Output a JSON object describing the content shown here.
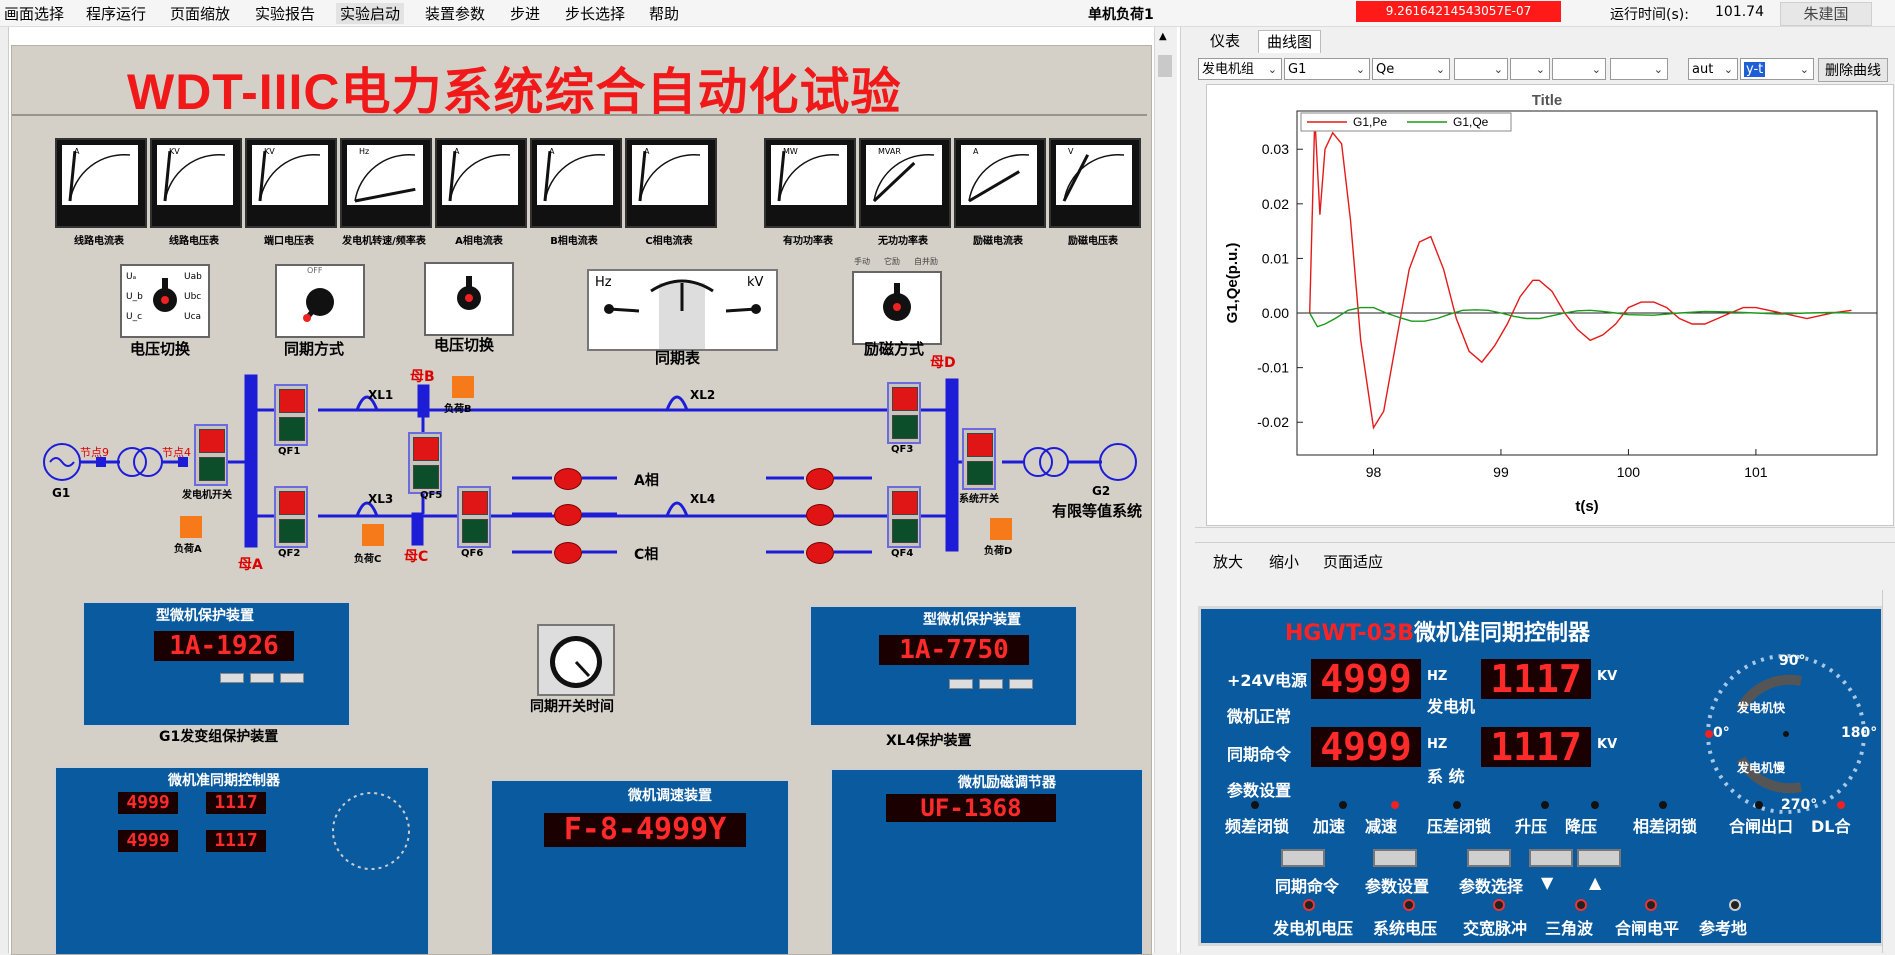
{
  "menu": {
    "items": [
      "画面选择",
      "程序运行",
      "页面缩放",
      "实验报告",
      "实验启动",
      "装置参数",
      "步进",
      "步长选择",
      "帮助"
    ],
    "mode": "单机负荷1",
    "warning": "9.26164214543057E-07",
    "runtime_label": "运行时间(s):",
    "runtime_value": "101.74",
    "user": "朱建国"
  },
  "panel": {
    "title": "WDT-IIIC电力系统综合自动化试验",
    "meters_left": [
      {
        "unit": "A",
        "label": "线路电流表",
        "needle": 0.05
      },
      {
        "unit": "KV",
        "label": "线路电压表",
        "needle": 0.05
      },
      {
        "unit": "KV",
        "label": "端口电压表",
        "needle": 0.05
      },
      {
        "unit": "Hz",
        "label": "发电机转速/频率表",
        "needle": 0.85
      },
      {
        "unit": "A",
        "label": "A相电流表",
        "needle": 0.05
      },
      {
        "unit": "A",
        "label": "B相电流表",
        "needle": 0.05
      },
      {
        "unit": "A",
        "label": "C相电流表",
        "needle": 0.05
      }
    ],
    "meters_right": [
      {
        "unit": "MW",
        "label": "有功功率表",
        "needle": 0.05
      },
      {
        "unit": "MVAR",
        "label": "无功功率表",
        "needle": 0.45
      },
      {
        "unit": "A",
        "label": "励磁电流表",
        "needle": 0.6
      },
      {
        "unit": "V",
        "label": "励磁电压表",
        "needle": 0.25
      }
    ],
    "switches": {
      "voltage_switch_1": "电压切换",
      "sync_mode": "同期方式",
      "voltage_switch_2": "电压切换",
      "sync_meter": "同期表",
      "excitation_mode": "励磁方式",
      "sync_off": "OFF",
      "exc_labels": [
        "手动",
        "它励",
        "自并励"
      ],
      "knob_ua": "Uₐ",
      "knob_ub": "U_b",
      "knob_uc": "U_c",
      "knob_uab": "Uab",
      "knob_ubc": "Ubc",
      "knob_uca": "Uca",
      "sync_hz": "Hz",
      "sync_kv": "kV"
    },
    "diagram": {
      "g1": "G1",
      "g2": "G2",
      "node9": "节点9",
      "node4": "节点4",
      "gen_switch": "发电机开关",
      "sys_switch": "系统开关",
      "inf_sys": "有限等值系统",
      "xl1": "XL1",
      "xl2": "XL2",
      "xl3": "XL3",
      "xl4": "XL4",
      "qf1": "QF1",
      "qf2": "QF2",
      "qf3": "QF3",
      "qf4": "QF4",
      "qf5": "QF5",
      "qf6": "QF6",
      "bus_a": "母A",
      "bus_b": "母B",
      "bus_c": "母C",
      "bus_d": "母D",
      "load_a": "负荷A",
      "load_b": "负荷B",
      "load_c": "负荷C",
      "load_d": "负荷D",
      "phase_a": "A相",
      "phase_c": "C相"
    },
    "prot1": {
      "title": "型微机保护装置",
      "disp": "1A-1926",
      "caption": "G1发变组保护装置"
    },
    "prot2": {
      "title": "型微机保护装置",
      "disp": "1A-7750",
      "caption": "XL4保护装置"
    },
    "sync_timer": "同期开关时间",
    "small_sync": {
      "title": "微机准同期控制器",
      "d1": "4999",
      "d2": "1117",
      "d3": "4999",
      "d4": "1117"
    },
    "speed": {
      "title": "微机调速装置",
      "disp": "F-8-4999Y"
    },
    "exc": {
      "title": "微机励磁调节器",
      "disp": "UF-1368"
    }
  },
  "right": {
    "tabs": [
      "仪表",
      "曲线图"
    ],
    "selects": [
      "发电机组",
      "G1",
      "Qe",
      "",
      "",
      "",
      "",
      "aut",
      "y-t"
    ],
    "delete_btn": "删除曲线",
    "toolbar": [
      "放大",
      "缩小",
      "页面适应"
    ]
  },
  "chart_data": {
    "type": "line",
    "title": "Title",
    "xlabel": "t(s)",
    "ylabel": "G1,Qe(p.u.)",
    "xlim": [
      97.4,
      101.95
    ],
    "ylim": [
      -0.026,
      0.037
    ],
    "xticks": [
      98,
      99,
      100,
      101
    ],
    "yticks": [
      0.03,
      0.02,
      0.01,
      0.0,
      -0.01,
      -0.02
    ],
    "ytick_labels": [
      "0.03",
      "0.02",
      "0.01",
      "0.00",
      "-0.01",
      "-0.02"
    ],
    "legend_placement": "top-left",
    "series": [
      {
        "name": "G1,Pe",
        "color": "#e41a1a",
        "x": [
          97.5,
          97.54,
          97.58,
          97.62,
          97.68,
          97.75,
          97.82,
          97.9,
          98.0,
          98.08,
          98.18,
          98.28,
          98.36,
          98.45,
          98.55,
          98.65,
          98.75,
          98.85,
          98.95,
          99.05,
          99.15,
          99.25,
          99.3,
          99.4,
          99.5,
          99.6,
          99.7,
          99.8,
          99.9,
          100.0,
          100.1,
          100.2,
          100.3,
          100.4,
          100.5,
          100.6,
          100.7,
          100.8,
          100.9,
          101.0,
          101.2,
          101.4,
          101.6,
          101.75
        ],
        "y": [
          0.0,
          0.036,
          0.018,
          0.03,
          0.033,
          0.031,
          0.017,
          -0.005,
          -0.021,
          -0.018,
          -0.005,
          0.008,
          0.013,
          0.014,
          0.008,
          -0.001,
          -0.007,
          -0.009,
          -0.006,
          -0.002,
          0.003,
          0.006,
          0.006,
          0.004,
          0.0,
          -0.003,
          -0.005,
          -0.004,
          -0.002,
          0.001,
          0.002,
          0.002,
          0.001,
          -0.001,
          -0.002,
          -0.002,
          -0.001,
          0.0,
          0.001,
          0.001,
          0.0,
          -0.001,
          0.0,
          0.0005
        ]
      },
      {
        "name": "G1,Qe",
        "color": "#1a9a1a",
        "x": [
          97.5,
          97.56,
          97.62,
          97.7,
          97.8,
          97.9,
          98.0,
          98.1,
          98.2,
          98.3,
          98.4,
          98.5,
          98.6,
          98.7,
          98.8,
          98.9,
          99.0,
          99.1,
          99.2,
          99.3,
          99.4,
          99.5,
          99.6,
          99.7,
          99.8,
          99.9,
          100.0,
          100.2,
          100.4,
          100.6,
          100.8,
          101.0,
          101.2,
          101.4,
          101.6,
          101.75
        ],
        "y": [
          0.0,
          -0.0025,
          -0.002,
          -0.001,
          0.0005,
          0.001,
          0.001,
          0.0,
          -0.0008,
          -0.0015,
          -0.0015,
          -0.001,
          -0.0002,
          0.0005,
          0.0006,
          0.0005,
          0.0,
          -0.0006,
          -0.001,
          -0.001,
          -0.0005,
          0.0,
          0.0004,
          0.0005,
          0.0003,
          0.0,
          -0.0003,
          -0.0004,
          0.0,
          0.0003,
          0.0002,
          0.0,
          -0.0002,
          0.0,
          0.0001,
          0.0
        ]
      }
    ]
  },
  "big_sync": {
    "title_red": "HGWT-03B",
    "title": "微机准同期控制器",
    "left_labels": [
      "+24V电源",
      "微机正常",
      "同期命令",
      "参数设置"
    ],
    "d_gen_hz": "4999",
    "d_gen_kv": "1117",
    "d_sys_hz": "4999",
    "d_sys_kv": "1117",
    "hz": "HZ",
    "kv": "KV",
    "gen": "发电机",
    "sys": "系 统",
    "row_labels": [
      "频差闭锁",
      "加速",
      "减速",
      "压差闭锁",
      "升压",
      "降压",
      "相差闭锁",
      "合闸出口",
      "DL合"
    ],
    "btn_labels": [
      "同期命令",
      "参数设置",
      "参数选择",
      "▼",
      "▲"
    ],
    "bottom_labels": [
      "发电机电压",
      "系统电压",
      "交宽脉冲",
      "三角波",
      "合闸电平",
      "参考地"
    ],
    "dial": {
      "d90": "90°",
      "d180": "180°",
      "d270": "270°",
      "d0": "0°",
      "fast": "发电机快",
      "slow": "发电机慢"
    }
  }
}
